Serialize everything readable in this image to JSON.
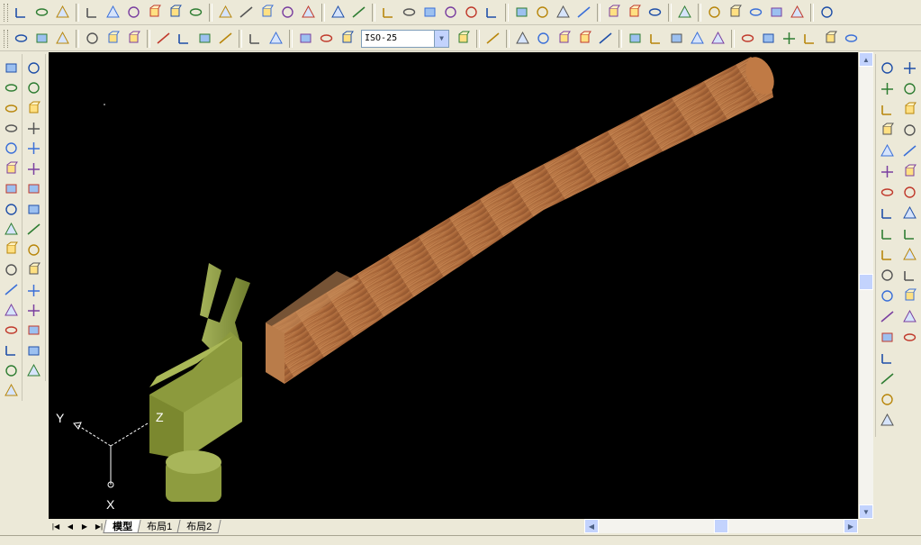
{
  "toolbar": {
    "dimstyle_value": "ISO-25"
  },
  "viewport": {
    "ucs": {
      "x_label": "X",
      "y_label": "Y",
      "z_label": "Z"
    },
    "background": "#000000",
    "handle_color": "#b5703f",
    "head_color": "#8e9c3f"
  },
  "layout_tabs": [
    {
      "label": "模型",
      "active": true
    },
    {
      "label": "布局1",
      "active": false
    },
    {
      "label": "布局2",
      "active": false
    }
  ],
  "icons": {
    "top_row1": [
      "ucs-icon",
      "ucs-world-icon",
      "ucs-previous-icon",
      "ucs-face-icon",
      "ucs-object-icon",
      "ucs-view-icon",
      "ucs-origin-icon",
      "ucs-zaxis-icon",
      "ucs-3point-icon",
      "ucs-x-icon",
      "ucs-y-icon",
      "ucs-z-icon",
      "ucs-apply-icon",
      "named-ucs-icon",
      "shade-2d-icon",
      "view-top-icon",
      "view-bottom-icon",
      "view-left-icon",
      "view-right-icon",
      "view-front-icon",
      "view-back-icon",
      "iso-sw-icon",
      "iso-se-icon",
      "iso-ne-icon",
      "iso-nw-icon",
      "camera-icon",
      "render-icon",
      "scene-icon",
      "lights-icon",
      "materials-icon",
      "mapping-icon",
      "landscape-icon",
      "background-icon",
      "fog-icon",
      "render-prefs-icon",
      "statistics-icon"
    ],
    "top_row2": [
      "linear-dim-icon",
      "aligned-dim-icon",
      "ordinate-dim-icon",
      "radius-dim-icon",
      "diameter-dim-icon",
      "angular-dim-icon",
      "quick-dim-icon",
      "baseline-dim-icon",
      "continue-dim-icon",
      "leader-icon",
      "tolerance-icon",
      "center-mark-icon",
      "dim-edit-icon",
      "dim-text-edit-icon",
      "dim-update-icon",
      "dim-style-icon",
      "section-icon",
      "slice-icon",
      "box-icon",
      "wedge-icon",
      "cone-icon",
      "solid-cone-icon",
      "sphere-icon",
      "dome-icon",
      "dish-icon",
      "torus-icon",
      "mesh-icon",
      "pyramid-icon",
      "revolved-icon",
      "edge-surface-icon",
      "ruled-icon",
      "tabulated-icon",
      "surface-3d-icon"
    ],
    "left_draw": [
      "line-icon",
      "construction-line-icon",
      "polyline-icon",
      "polygon-icon",
      "rectangle-icon",
      "arc-icon",
      "circle-icon",
      "revision-cloud-icon",
      "spline-icon",
      "ellipse-icon",
      "ellipse-arc-icon",
      "insert-block-icon",
      "make-block-icon",
      "point-icon",
      "hatch-icon",
      "region-icon",
      "multiline-text-icon"
    ],
    "left_modify": [
      "erase-icon",
      "copy-icon",
      "mirror-icon",
      "offset-icon",
      "array-icon",
      "move-icon",
      "rotate-icon",
      "scale-icon",
      "stretch-icon",
      "trim-icon",
      "extend-icon",
      "break-at-point-icon",
      "break-icon",
      "chamfer-icon",
      "fillet-icon",
      "explode-icon"
    ],
    "right_solids": [
      "union-icon",
      "subtract-icon",
      "intersect-icon",
      "extrude-faces-icon",
      "move-faces-icon",
      "offset-faces-icon",
      "delete-faces-icon",
      "rotate-faces-icon",
      "taper-faces-icon",
      "copy-faces-icon",
      "color-faces-icon",
      "copy-edges-icon",
      "color-edges-icon",
      "imprint-icon",
      "clean-icon",
      "separate-icon",
      "shell-icon",
      "check-icon"
    ],
    "right_solids2": [
      "box-solid-icon",
      "sphere-solid-icon",
      "cylinder-solid-icon",
      "cone-solid-icon",
      "wedge-solid-icon",
      "torus-solid-icon",
      "extrude-icon",
      "revolve-icon",
      "slice-solid-icon",
      "section-solid-icon",
      "interfere-icon",
      "setup-drawing-icon",
      "setup-view-icon",
      "setup-profile-icon"
    ]
  }
}
